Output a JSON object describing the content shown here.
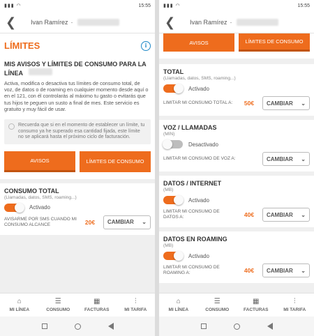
{
  "status": {
    "time": "15:55"
  },
  "appbar": {
    "user": "Ivan Ramírez",
    "separator": "·"
  },
  "left": {
    "page_title": "LÍMITES",
    "info_icon": "i",
    "heading": "MIS AVISOS Y LÍMITES DE CONSUMO PARA LA LÍNEA",
    "intro": "Activa, modifica o desactiva tus límites de consumo total, de voz, de datos o de roaming en cualquier momento desde aquí o en el 121, con él controlarás al máximo tu gasto o evitarás que tus hijos te peguen un susto a final de mes. Este servicio es gratuito y muy fácil de usar.",
    "notice": "Recuerda que si en el momento de establecer un límite, tu consumo ya he superado esa cantidad fijada, este límite no se aplicará hasta el próximo ciclo de facturación.",
    "tabs": {
      "avisos": "AVISOS",
      "limites": "LÍMITES DE CONSUMO"
    },
    "section": {
      "title": "CONSUMO TOTAL",
      "subtitle": "(Llamadas, datos, SMS, roaming...)",
      "toggle_label": "Activado",
      "limit_label": "AVISARME POR SMS CUANDO MI CONSUMO ALCANCE",
      "amount": "20€",
      "button": "CAMBIAR"
    }
  },
  "right": {
    "tabs": {
      "avisos": "AVISOS",
      "limites": "LÍMITES DE CONSUMO"
    },
    "sections": [
      {
        "title": "TOTAL",
        "subtitle": "(Llamadas, datos, SMS, roaming...)",
        "toggle_state": "on",
        "toggle_label": "Activado",
        "limit_label": "LIMITAR MI CONSUMO TOTAL A:",
        "amount": "50€",
        "button": "CAMBIAR"
      },
      {
        "title": "VOZ / LLAMADAS",
        "subtitle": "(MIN)",
        "toggle_state": "off",
        "toggle_label": "Desactivado",
        "limit_label": "LIMITAR MI CONSUMO DE VOZ A:",
        "amount": "",
        "button": "CAMBIAR"
      },
      {
        "title": "DATOS / INTERNET",
        "subtitle": "(MB)",
        "toggle_state": "on",
        "toggle_label": "Activado",
        "limit_label": "LIMITAR MI CONSUMO DE DATOS A:",
        "amount": "40€",
        "button": "CAMBIAR"
      },
      {
        "title": "DATOS EN ROAMING",
        "subtitle": "(MB)",
        "toggle_state": "on",
        "toggle_label": "Activado",
        "limit_label": "LIMITAR MI CONSUMO DE ROAMING A:",
        "amount": "40€",
        "button": "CAMBIAR"
      }
    ]
  },
  "nav": {
    "items": [
      "MI LÍNEA",
      "CONSUMO",
      "FACTURAS",
      "MI TARIFA"
    ]
  },
  "colors": {
    "accent": "#ee6c1d",
    "info": "#1e88c7"
  }
}
